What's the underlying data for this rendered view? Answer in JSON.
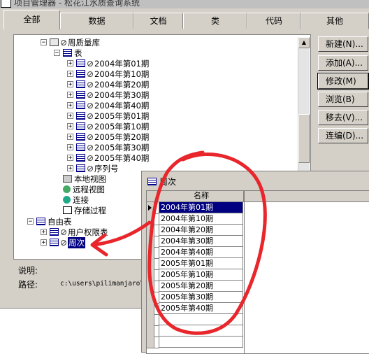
{
  "project_manager": {
    "title": "项目管理器 - 松花江水质查询系统",
    "tabs": [
      "全部",
      "数据",
      "文档",
      "类",
      "代码",
      "其他"
    ],
    "active_tab": "全部",
    "tree": {
      "database": "周质量库",
      "tables_label": "表",
      "tables": [
        "2004年第01期",
        "2004年第10期",
        "2004年第20期",
        "2004年第30期",
        "2004年第40期",
        "2005年第01期",
        "2005年第10期",
        "2005年第20期",
        "2005年第30期",
        "2005年第40期",
        "序列号"
      ],
      "local_views": "本地视图",
      "remote_views": "远程视图",
      "connections": "连接",
      "stored_procs": "存储过程",
      "free_tables": "自由表",
      "free_table_items": [
        "用户权限表",
        "周次"
      ]
    },
    "buttons": [
      "新建(N)...",
      "添加(A)...",
      "修改(M)",
      "浏览(B)",
      "移去(V)...",
      "连编(D)..."
    ],
    "info": {
      "description_label": "说明:",
      "path_label": "路径:",
      "path_value": "c:\\users\\pilimanjaro\\"
    }
  },
  "browse_window": {
    "title": "周次",
    "column_header": "名称",
    "rows": [
      "2004年第01期",
      "2004年第10期",
      "2004年第20期",
      "2004年第30期",
      "2004年第40期",
      "2005年第01期",
      "2005年第10期",
      "2005年第20期",
      "2005年第30期",
      "2005年第40期"
    ]
  },
  "colors": {
    "selection": "#000080",
    "annotation": "#e8262b",
    "face": "#d4d0c8"
  }
}
